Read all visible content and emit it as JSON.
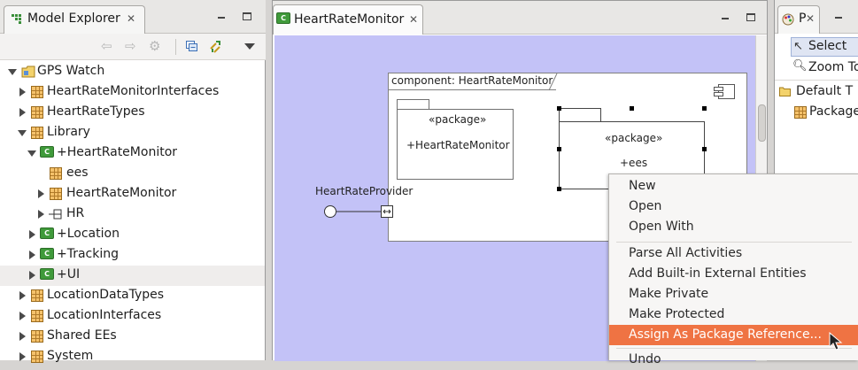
{
  "explorer": {
    "title": "Model Explorer",
    "tree": [
      {
        "label": "GPS Watch",
        "icon": "project-icon",
        "depth": 0,
        "state": "expanded"
      },
      {
        "label": "HeartRateMonitorInterfaces",
        "icon": "package-icon",
        "depth": 1,
        "state": "collapsed"
      },
      {
        "label": "HeartRateTypes",
        "icon": "package-icon",
        "depth": 1,
        "state": "collapsed"
      },
      {
        "label": "Library",
        "icon": "package-icon",
        "depth": 1,
        "state": "expanded"
      },
      {
        "label": "+HeartRateMonitor",
        "icon": "component-icon",
        "depth": 2,
        "state": "expanded"
      },
      {
        "label": "ees",
        "icon": "package-icon",
        "depth": 3,
        "state": "leaf"
      },
      {
        "label": "HeartRateMonitor",
        "icon": "package-icon",
        "depth": 3,
        "state": "collapsed"
      },
      {
        "label": "HR",
        "icon": "interface-icon",
        "depth": 3,
        "state": "collapsed"
      },
      {
        "label": "+Location",
        "icon": "component-icon",
        "depth": 2,
        "state": "collapsed"
      },
      {
        "label": "+Tracking",
        "icon": "component-icon",
        "depth": 2,
        "state": "collapsed"
      },
      {
        "label": "+UI",
        "icon": "component-icon",
        "depth": 2,
        "state": "collapsed"
      },
      {
        "label": "LocationDataTypes",
        "icon": "package-icon",
        "depth": 1,
        "state": "collapsed"
      },
      {
        "label": "LocationInterfaces",
        "icon": "package-icon",
        "depth": 1,
        "state": "collapsed"
      },
      {
        "label": "Shared EEs",
        "icon": "package-icon",
        "depth": 1,
        "state": "collapsed"
      },
      {
        "label": "System",
        "icon": "package-icon",
        "depth": 1,
        "state": "collapsed"
      }
    ]
  },
  "editor": {
    "tab_title": "HeartRateMonitor",
    "component_label": "component: HeartRateMonitor",
    "package1_stereotype": "«package»",
    "package1_name": "+HeartRateMonitor",
    "package2_stereotype": "«package»",
    "package2_name": "+ees",
    "port_label": "HeartRateProvider",
    "canvas_color": "#c3c2f7"
  },
  "palette": {
    "tab_title": "P",
    "items": [
      "Select",
      "Zoom To",
      "Default T",
      "Package"
    ]
  },
  "context_menu": {
    "items": [
      "New",
      "Open",
      "Open With",
      "Parse All Activities",
      "Add Built-in External Entities",
      "Make Private",
      "Make Protected",
      "Assign As Package Reference...",
      "Undo"
    ],
    "highlighted": "Assign As Package Reference...",
    "highlight_color": "#ef7343"
  }
}
